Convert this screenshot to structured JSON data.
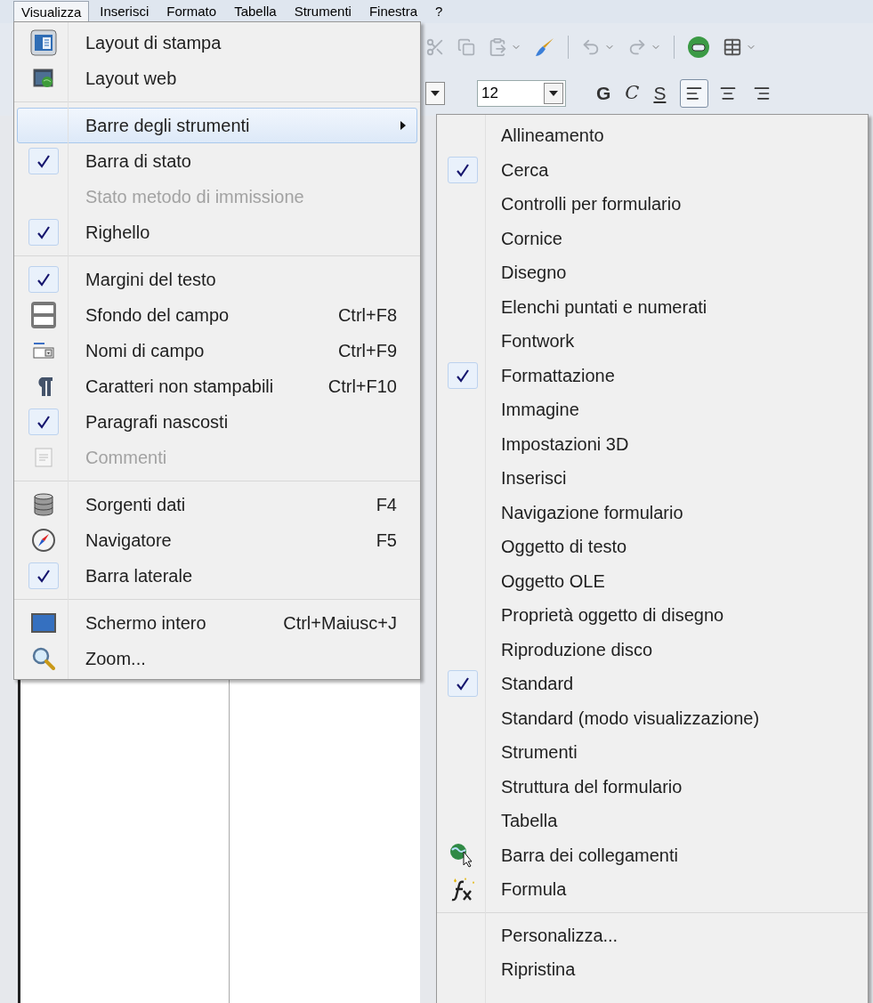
{
  "menubar": [
    {
      "label": "Visualizza",
      "selected": true
    },
    {
      "label": "Inserisci",
      "selected": false
    },
    {
      "label": "Formato",
      "selected": false
    },
    {
      "label": "Tabella",
      "selected": false
    },
    {
      "label": "Strumenti",
      "selected": false
    },
    {
      "label": "Finestra",
      "selected": false
    },
    {
      "label": "?",
      "selected": false
    }
  ],
  "toolbar": {
    "font_size": "12",
    "format_buttons": [
      {
        "label": "G",
        "kind": "bold"
      },
      {
        "label": "C",
        "kind": "italic"
      },
      {
        "label": "S",
        "kind": "underline"
      }
    ],
    "align_buttons": [
      {
        "kind": "left",
        "selected": true
      },
      {
        "kind": "center",
        "selected": false
      },
      {
        "kind": "right",
        "selected": false
      }
    ]
  },
  "main_menu": {
    "groups": [
      {
        "items": [
          {
            "label": "Layout di stampa",
            "kind": "page",
            "checked": false,
            "disabled": false,
            "selected": false
          },
          {
            "label": "Layout web",
            "kind": "web",
            "checked": false,
            "disabled": false,
            "selected": false
          }
        ]
      },
      {
        "items": [
          {
            "label": "Barre degli strumenti",
            "kind": "plain",
            "submenu": true,
            "checked": false,
            "disabled": false,
            "selected": true
          },
          {
            "label": "Barra di stato",
            "kind": "plain",
            "checked": true,
            "disabled": false,
            "selected": false
          },
          {
            "label": "Stato metodo di immissione",
            "kind": "plain",
            "checked": false,
            "disabled": true,
            "selected": false
          },
          {
            "label": "Righello",
            "kind": "plain",
            "checked": true,
            "disabled": false,
            "selected": false
          }
        ]
      },
      {
        "items": [
          {
            "label": "Margini del testo",
            "kind": "plain",
            "checked": true,
            "disabled": false,
            "selected": false
          },
          {
            "label": "Sfondo del campo",
            "shortcut": "Ctrl+F8",
            "kind": "shading",
            "checked": false,
            "disabled": false,
            "selected": false
          },
          {
            "label": "Nomi di campo",
            "shortcut": "Ctrl+F9",
            "kind": "fieldnames",
            "checked": false,
            "disabled": false,
            "selected": false
          },
          {
            "label": "Caratteri non stampabili",
            "shortcut": "Ctrl+F10",
            "kind": "pilcrow",
            "checked": false,
            "disabled": false,
            "selected": false
          },
          {
            "label": "Paragrafi nascosti",
            "kind": "plain",
            "checked": true,
            "disabled": false,
            "selected": false
          },
          {
            "label": "Commenti",
            "kind": "comment",
            "checked": false,
            "disabled": true,
            "selected": false
          }
        ]
      },
      {
        "items": [
          {
            "label": "Sorgenti dati",
            "shortcut": "F4",
            "kind": "database",
            "checked": false,
            "disabled": false,
            "selected": false
          },
          {
            "label": "Navigatore",
            "shortcut": "F5",
            "kind": "compass",
            "checked": false,
            "disabled": false,
            "selected": false
          },
          {
            "label": "Barra laterale",
            "kind": "plain",
            "checked": true,
            "disabled": false,
            "selected": false
          }
        ]
      },
      {
        "items": [
          {
            "label": "Schermo intero",
            "shortcut": "Ctrl+Maiusc+J",
            "kind": "fullscreen",
            "checked": false,
            "disabled": false,
            "selected": false
          },
          {
            "label": "Zoom...",
            "kind": "zoom",
            "checked": false,
            "disabled": false,
            "selected": false
          }
        ]
      }
    ]
  },
  "submenu": {
    "groups": [
      {
        "items": [
          {
            "label": "Allineamento",
            "kind": "plain",
            "checked": false
          },
          {
            "label": "Cerca",
            "kind": "plain",
            "checked": true
          },
          {
            "label": "Controlli per formulario",
            "kind": "plain",
            "checked": false
          },
          {
            "label": "Cornice",
            "kind": "plain",
            "checked": false
          },
          {
            "label": "Disegno",
            "kind": "plain",
            "checked": false
          },
          {
            "label": "Elenchi puntati e numerati",
            "kind": "plain",
            "checked": false
          },
          {
            "label": "Fontwork",
            "kind": "plain",
            "checked": false
          },
          {
            "label": "Formattazione",
            "kind": "plain",
            "checked": true
          },
          {
            "label": "Immagine",
            "kind": "plain",
            "checked": false
          },
          {
            "label": "Impostazioni 3D",
            "kind": "plain",
            "checked": false
          },
          {
            "label": "Inserisci",
            "kind": "plain",
            "checked": false
          },
          {
            "label": "Navigazione formulario",
            "kind": "plain",
            "checked": false
          },
          {
            "label": "Oggetto di testo",
            "kind": "plain",
            "checked": false
          },
          {
            "label": "Oggetto OLE",
            "kind": "plain",
            "checked": false
          },
          {
            "label": "Proprietà oggetto di disegno",
            "kind": "plain",
            "checked": false
          },
          {
            "label": "Riproduzione disco",
            "kind": "plain",
            "checked": false
          },
          {
            "label": "Standard",
            "kind": "plain",
            "checked": true
          },
          {
            "label": "Standard (modo visualizzazione)",
            "kind": "plain",
            "checked": false
          },
          {
            "label": "Strumenti",
            "kind": "plain",
            "checked": false
          },
          {
            "label": "Struttura del formulario",
            "kind": "plain",
            "checked": false
          },
          {
            "label": "Tabella",
            "kind": "plain",
            "checked": false
          },
          {
            "label": "Barra dei collegamenti",
            "kind": "hyperlink",
            "checked": false
          },
          {
            "label": "Formula",
            "kind": "formula",
            "checked": false
          }
        ]
      },
      {
        "items": [
          {
            "label": "Personalizza...",
            "kind": "plain",
            "checked": false
          },
          {
            "label": "Ripristina",
            "kind": "plain",
            "checked": false
          }
        ]
      }
    ]
  }
}
